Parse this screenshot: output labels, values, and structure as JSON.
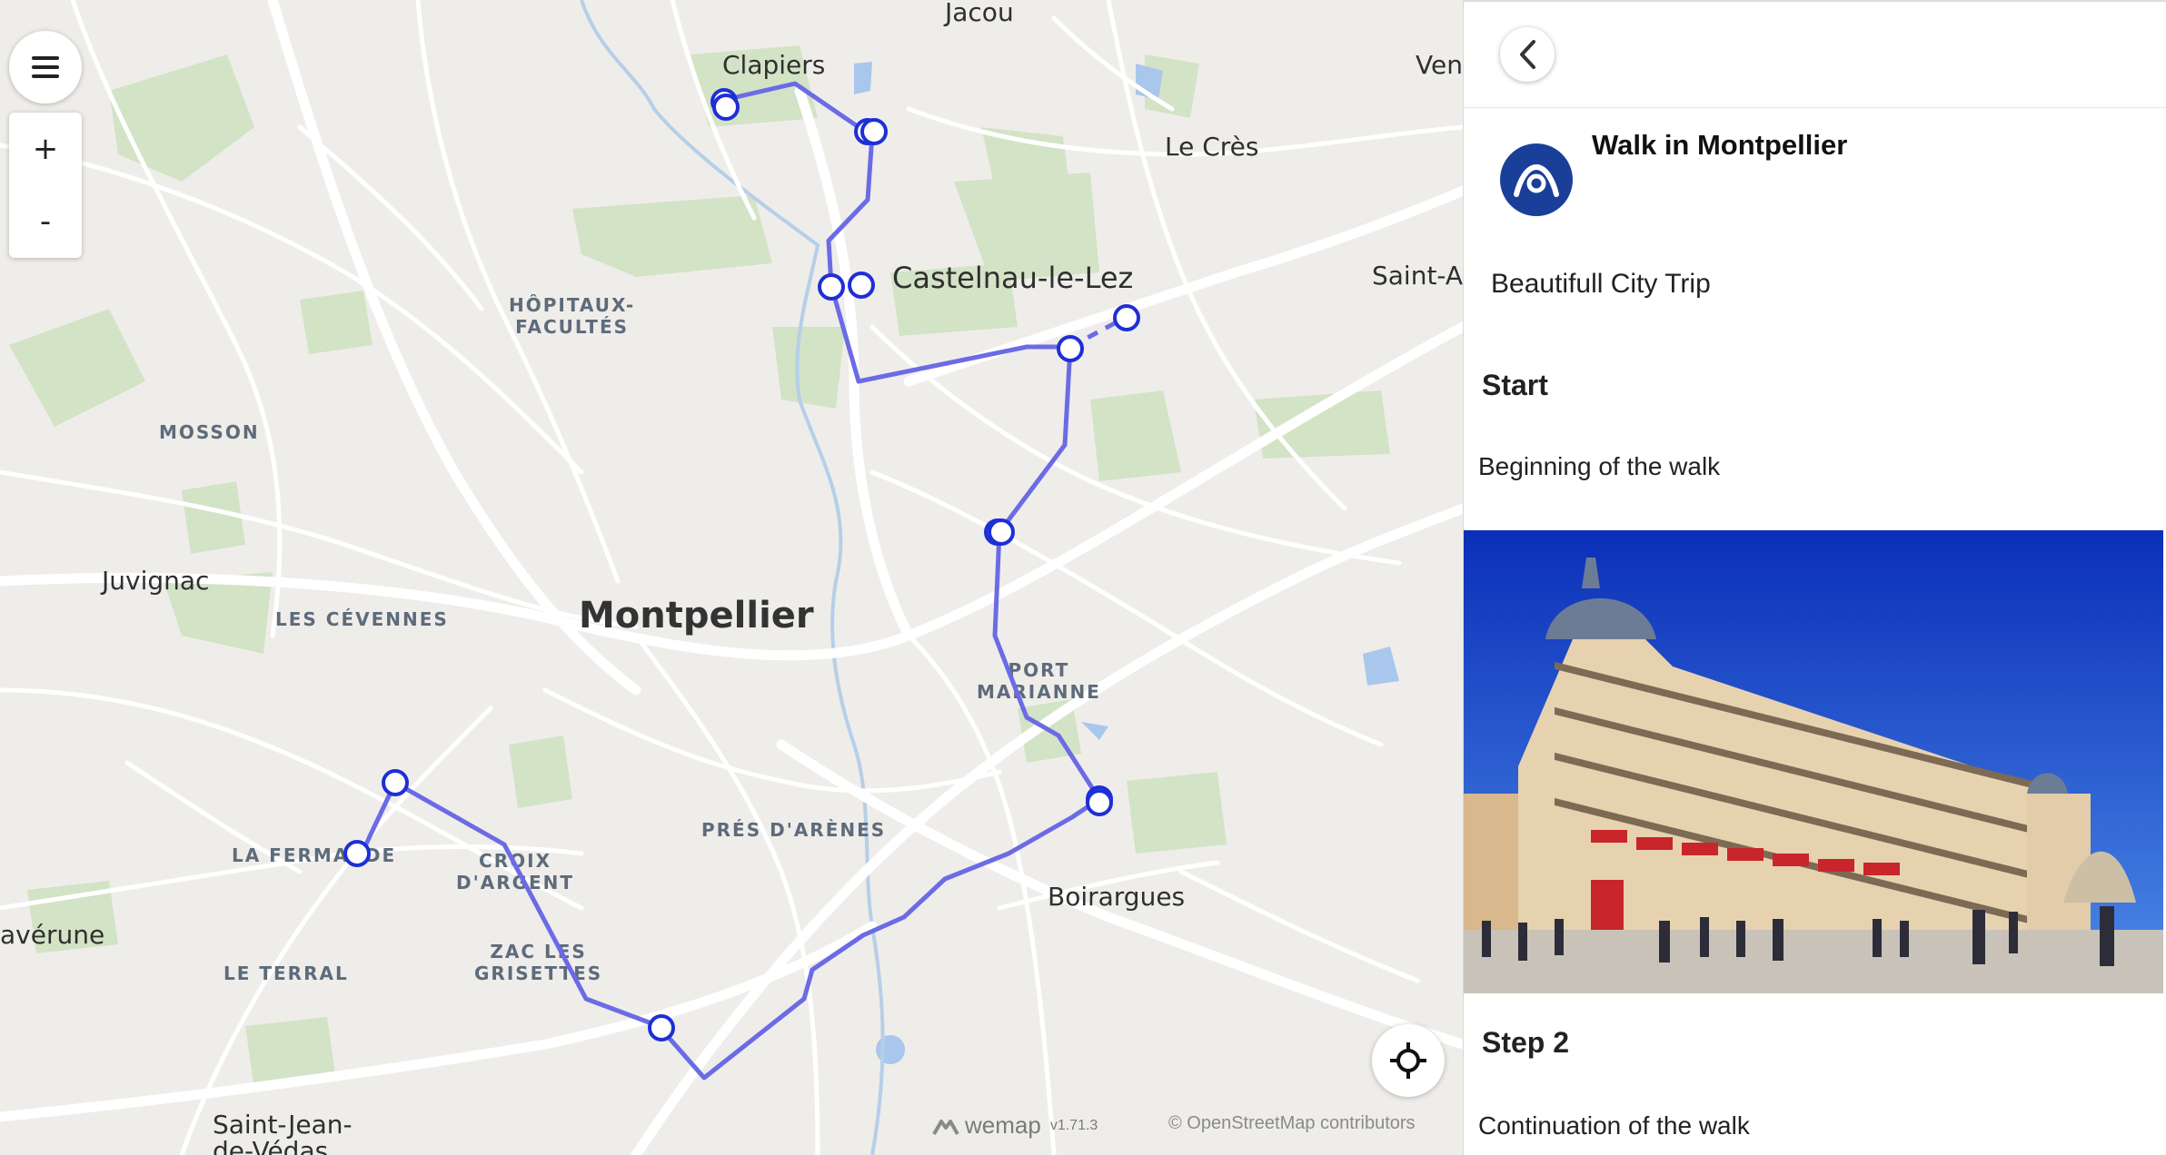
{
  "map": {
    "places": {
      "jacou": "Jacou",
      "clapiers": "Clapiers",
      "vendargues": "Ven",
      "le_cres": "Le Crès",
      "castelnau": "Castelnau-le-Lez",
      "saint_aunes": "Saint-Au",
      "hopitaux": "HÔPITAUX-\nFACULTÉS",
      "mosson": "MOSSON",
      "juvignac": "Juvignac",
      "les_cevennes": "LES CÉVENNES",
      "montpellier": "Montpellier",
      "port_marianne": "PORT\nMARIANNE",
      "la_fermaude": "LA FERMAUDE",
      "croix_dargent": "CROIX\nD'ARGENT",
      "pres_darenes": "PRÉS D'ARÈNES",
      "boirargues": "Boirargues",
      "laverune": "avérune",
      "zac_grisettes": "ZAC LES\nGRISETTES",
      "le_terral": "LE TERRAL",
      "saint_jean": "Saint-Jean-\nde-Védas"
    },
    "controls": {
      "menu_icon": "hamburger-menu-icon",
      "zoom_in": "+",
      "zoom_out": "-",
      "locate_icon": "crosshair-locate-icon"
    },
    "brand": {
      "name": "wemap",
      "version": "v1.71.3"
    },
    "attribution": "© OpenStreetMap contributors",
    "route_color": "#6b6be6",
    "marker_color": "#1e2fd6"
  },
  "panel": {
    "back_icon": "chevron-left-icon",
    "avatar_color": "#1a3f99",
    "walk_title": "Walk in Montpellier",
    "walk_description": "Beautifull City Trip",
    "steps": [
      {
        "title": "Start",
        "text": "Beginning of the walk"
      },
      {
        "title": "Step 2",
        "text": "Continuation of the walk"
      }
    ]
  }
}
